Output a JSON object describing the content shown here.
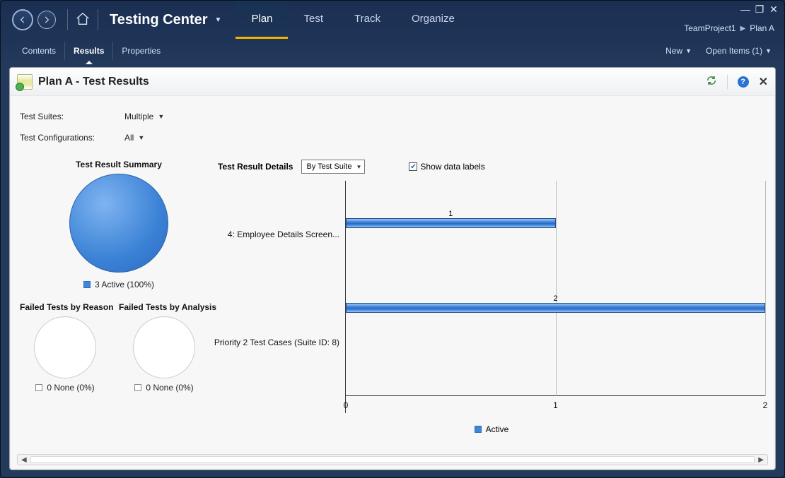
{
  "window_controls": {
    "minimize": "—",
    "restore": "❐",
    "close": "✕"
  },
  "header": {
    "title": "Testing Center",
    "tabs": [
      "Plan",
      "Test",
      "Track",
      "Organize"
    ],
    "active_tab_index": 0
  },
  "breadcrumb": {
    "project": "TeamProject1",
    "plan": "Plan A"
  },
  "subnav": {
    "tabs": [
      "Contents",
      "Results",
      "Properties"
    ],
    "active_index": 1,
    "right": {
      "new_label": "New",
      "open_items_label": "Open Items (1)"
    }
  },
  "panel": {
    "title": "Plan A - Test Results",
    "filters": {
      "suites_label": "Test Suites:",
      "suites_value": "Multiple",
      "configs_label": "Test Configurations:",
      "configs_value": "All"
    }
  },
  "summary": {
    "title": "Test Result Summary",
    "legend": "3 Active (100%)"
  },
  "failed": {
    "by_reason": {
      "title": "Failed Tests by Reason",
      "legend": "0 None (0%)"
    },
    "by_analysis": {
      "title": "Failed Tests by Analysis",
      "legend": "0 None (0%)"
    }
  },
  "details": {
    "title": "Test Result Details",
    "combo_value": "By Test Suite",
    "checkbox_label": "Show data labels",
    "checkbox_checked": true,
    "legend": "Active"
  },
  "chart_data": {
    "type": "bar",
    "orientation": "horizontal",
    "title": "Test Result Details",
    "xlabel": "",
    "ylabel": "",
    "xlim": [
      0,
      2
    ],
    "x_ticks": [
      0,
      1,
      2
    ],
    "categories": [
      "4: Employee Details Screen...",
      "Priority 2 Test Cases (Suite ID: 8)"
    ],
    "series": [
      {
        "name": "Active",
        "values": [
          1,
          2
        ]
      }
    ],
    "data_labels": true
  }
}
